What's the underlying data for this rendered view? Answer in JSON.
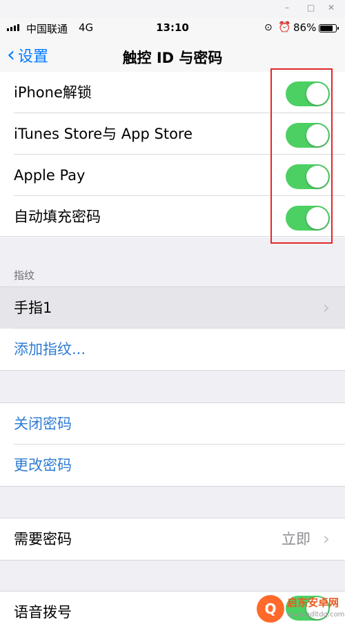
{
  "window_controls": {
    "minimize": "–",
    "maximize": "□",
    "close": "✕"
  },
  "status_bar": {
    "carrier": "中国联通",
    "network": "4G",
    "time": "13:10",
    "battery": "86%",
    "battery_level": 0.86
  },
  "nav": {
    "back_label": "设置",
    "title": "触控 ID 与密码"
  },
  "toggle_group": [
    {
      "label": "iPhone解锁",
      "on": true
    },
    {
      "label": "iTunes Store与 App Store",
      "on": true
    },
    {
      "label": "Apple Pay",
      "on": true
    },
    {
      "label": "自动填充密码",
      "on": true
    }
  ],
  "fingerprint": {
    "header": "指纹",
    "finger_1": "手指1",
    "add": "添加指纹..."
  },
  "passcode": {
    "turn_off": "关闭密码",
    "change": "更改密码"
  },
  "require_passcode": {
    "label": "需要密码",
    "value": "立即"
  },
  "voice_dial": {
    "label": "语音拨号"
  },
  "watermark": {
    "name": "启东安卓网",
    "url": "www.qdltdq.com"
  },
  "colors": {
    "accent": "#007aff",
    "toggle_on": "#4cd064",
    "highlight": "#e32626"
  }
}
